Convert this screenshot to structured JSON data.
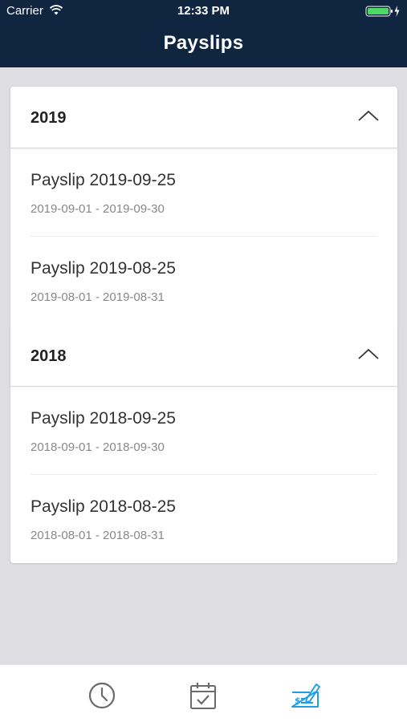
{
  "status_bar": {
    "carrier": "Carrier",
    "time": "12:33 PM"
  },
  "header": {
    "title": "Payslips"
  },
  "sections": [
    {
      "year": "2019",
      "items": [
        {
          "title": "Payslip 2019-09-25",
          "range": "2019-09-01 - 2019-09-30"
        },
        {
          "title": "Payslip 2019-08-25",
          "range": "2019-08-01 - 2019-08-31"
        }
      ]
    },
    {
      "year": "2018",
      "items": [
        {
          "title": "Payslip 2018-09-25",
          "range": "2018-09-01 - 2018-09-30"
        },
        {
          "title": "Payslip 2018-08-25",
          "range": "2018-08-01 - 2018-08-31"
        }
      ]
    }
  ],
  "tab_bar": {
    "tabs": [
      {
        "icon": "clock-icon",
        "active": false
      },
      {
        "icon": "calendar-check-icon",
        "active": false
      },
      {
        "icon": "payslip-cheque-icon",
        "active": true
      }
    ]
  },
  "colors": {
    "header_bg": "#0f2540",
    "page_bg": "#dddde2",
    "active_tab": "#1c9ee8",
    "inactive_tab": "#6a6a6a"
  }
}
